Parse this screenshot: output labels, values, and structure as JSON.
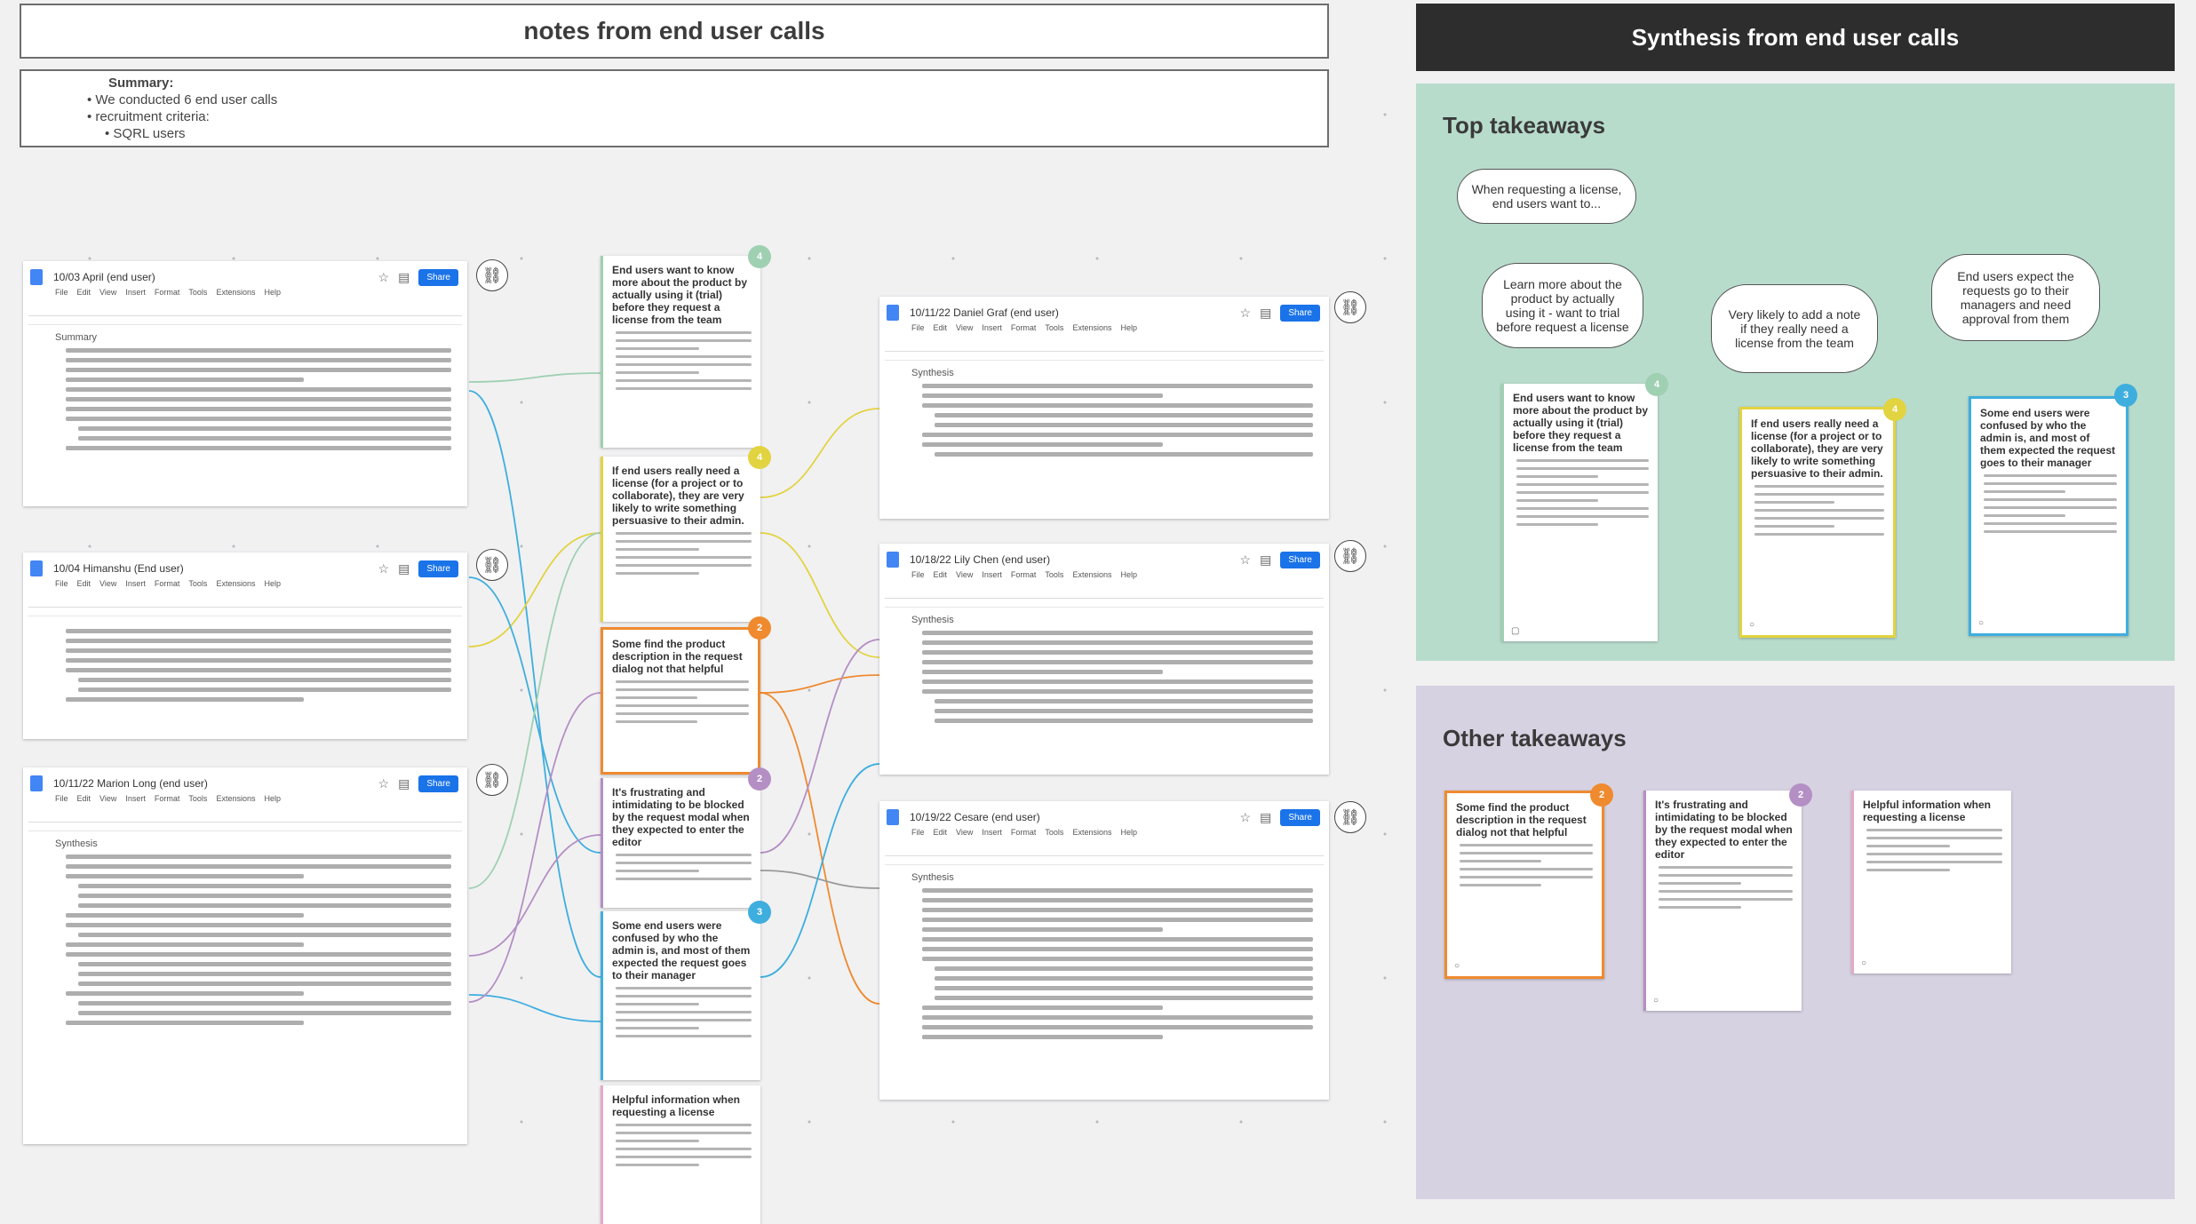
{
  "canvas": {
    "title_left": "notes from end user calls",
    "summary": {
      "title": "Summary:",
      "items": [
        "We conducted 6 end user calls",
        "recruitment criteria:"
      ],
      "subitems": [
        "SQRL users"
      ]
    },
    "title_right": "Synthesis from end user calls"
  },
  "docs": [
    {
      "title": "10/03 April (end user)",
      "heading": "Summary",
      "share": "Share"
    },
    {
      "title": "10/04 Himanshu (End user)",
      "heading": "",
      "share": "Share"
    },
    {
      "title": "10/11/22 Marion Long (end user)",
      "heading": "Synthesis",
      "share": "Share"
    },
    {
      "title": "10/11/22 Daniel Graf (end user)",
      "heading": "Synthesis",
      "share": "Share"
    },
    {
      "title": "10/18/22 Lily Chen (end user)",
      "heading": "Synthesis",
      "share": "Share"
    },
    {
      "title": "10/19/22 Cesare (end user)",
      "heading": "Synthesis",
      "share": "Share"
    }
  ],
  "doc_menu": [
    "File",
    "Edit",
    "View",
    "Insert",
    "Format",
    "Tools",
    "Extensions",
    "Help"
  ],
  "stickies_middle": [
    {
      "heading": "End users want to know more about the product by actually using it (trial) before they request a license from the team",
      "vote": "4"
    },
    {
      "heading": "If end users really need a license (for a project or to collaborate), they are very likely to write something persuasive to their admin.",
      "vote": "4"
    },
    {
      "heading": "Some find the product description in the request dialog not that helpful",
      "vote": "2"
    },
    {
      "heading": "It's frustrating and intimidating to be blocked by the request modal when they expected to enter the editor",
      "vote": "2"
    },
    {
      "heading": "Some end users were confused by who the admin is, and most of them expected the request goes to their manager",
      "vote": "3"
    },
    {
      "heading": "Helpful information when requesting a license",
      "vote": ""
    }
  ],
  "top_takeaways": {
    "title": "Top takeaways",
    "root": "When requesting a license, end users want to...",
    "nodes": [
      "Learn more about the product by actually using it - want to trial before request a license",
      "Very likely to add a note if they really need a license from the team",
      "End users expect the requests go to their managers and need approval from them"
    ],
    "stickies": [
      {
        "heading": "End users want to know more about the product by actually using it (trial) before they request a license from the team",
        "vote": "4"
      },
      {
        "heading": "If end users really need a license (for a project or to collaborate), they are very likely to write something persuasive to their admin.",
        "vote": "4"
      },
      {
        "heading": "Some end users were confused by who the admin is, and most of them expected the request goes to their manager",
        "vote": "3"
      }
    ]
  },
  "other_takeaways": {
    "title": "Other takeaways",
    "stickies": [
      {
        "heading": "Some find the product description in the request dialog not that helpful",
        "vote": "2"
      },
      {
        "heading": "It's frustrating and intimidating to be blocked by the request modal when they expected to enter the editor",
        "vote": "2"
      },
      {
        "heading": "Helpful information when requesting a license",
        "vote": ""
      }
    ]
  },
  "colors": {
    "green_panel": "#b8dccc",
    "purple_panel": "#d7d2e2",
    "vote_green": "#9fd0b2",
    "vote_yellow": "#e2d340",
    "vote_orange": "#ef8a2f",
    "vote_purple": "#b48fc4",
    "vote_blue": "#3eaede"
  }
}
